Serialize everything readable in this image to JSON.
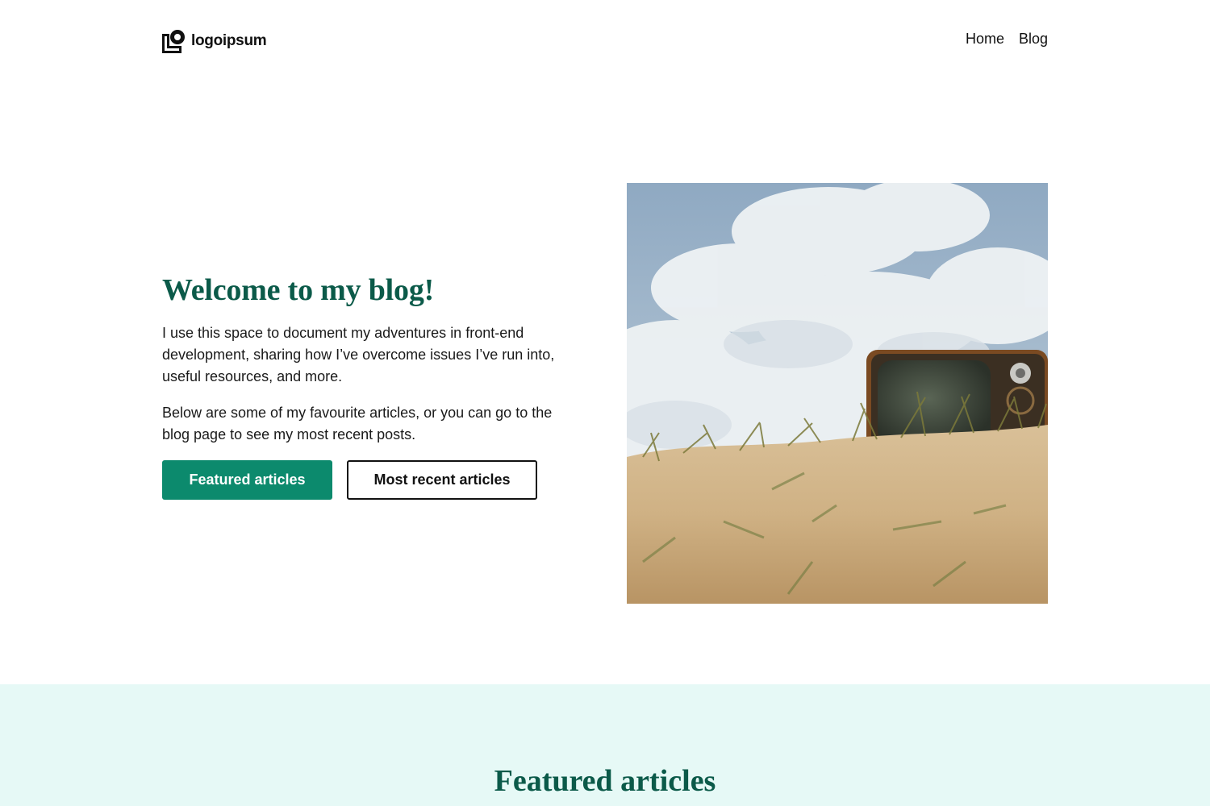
{
  "header": {
    "logo_text": "logoipsum",
    "nav": [
      {
        "label": "Home"
      },
      {
        "label": "Blog"
      }
    ]
  },
  "hero": {
    "title": "Welcome to my blog!",
    "paragraph_1": "I use this space to document my adventures in front-end development, sharing how I’ve overcome issues I’ve run into, useful resources, and more.",
    "paragraph_2": "Below are some of my favourite articles, or you can go to the blog page to see my most recent posts.",
    "primary_button": "Featured articles",
    "secondary_button": "Most recent articles",
    "image_icon": "vintage-tv-on-sand-dune-photo"
  },
  "featured": {
    "title": "Featured articles"
  },
  "colors": {
    "accent": "#0c8a6d",
    "heading": "#0b5a49",
    "section_bg": "#e6f9f6"
  }
}
